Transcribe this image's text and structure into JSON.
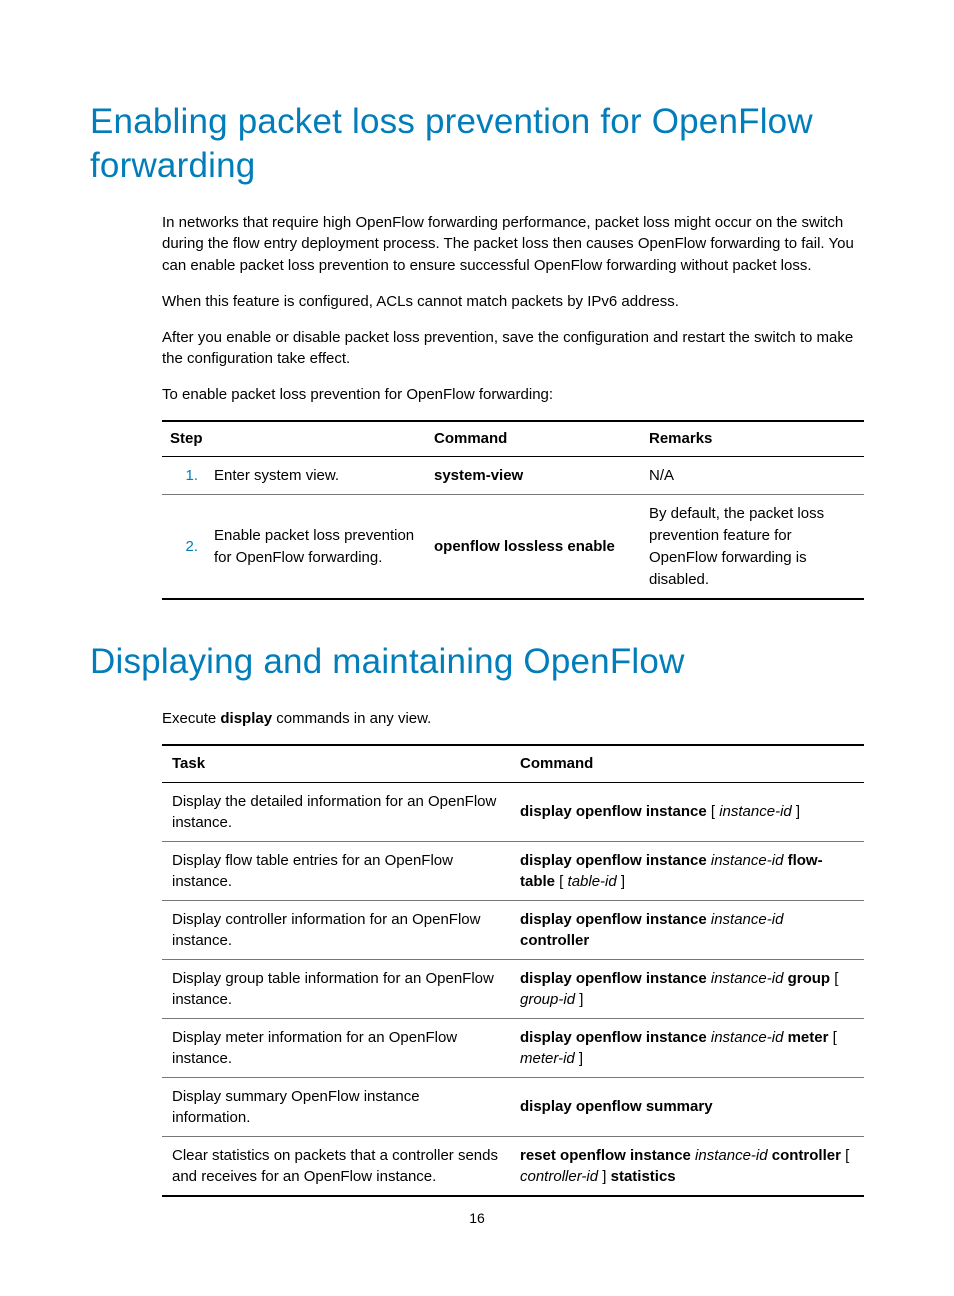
{
  "section1": {
    "title": "Enabling packet loss prevention for OpenFlow forwarding",
    "p1": "In networks that require high OpenFlow forwarding performance, packet loss might occur on the switch during the flow entry deployment process. The packet loss then causes OpenFlow forwarding to fail. You can enable packet loss prevention to ensure successful OpenFlow forwarding without packet loss.",
    "p2": "When this feature is configured, ACLs cannot match packets by IPv6 address.",
    "p3": "After you enable or disable packet loss prevention, save the configuration and restart the switch to make the configuration take effect.",
    "p4": "To enable packet loss prevention for OpenFlow forwarding:",
    "table": {
      "head_step": "Step",
      "head_command": "Command",
      "head_remarks": "Remarks",
      "rows": [
        {
          "num": "1.",
          "step": "Enter system view.",
          "command": "system-view",
          "remarks": "N/A"
        },
        {
          "num": "2.",
          "step": "Enable packet loss prevention for OpenFlow forwarding.",
          "command": "openflow lossless enable",
          "remarks": "By default, the packet loss prevention feature for OpenFlow forwarding is disabled."
        }
      ]
    }
  },
  "section2": {
    "title": "Displaying and maintaining OpenFlow",
    "intro_pre": "Execute ",
    "intro_bold": "display",
    "intro_post": " commands in any view.",
    "table": {
      "head_task": "Task",
      "head_command": "Command",
      "rows": [
        {
          "task": "Display the detailed information for an OpenFlow instance.",
          "cmd_parts": [
            {
              "t": "display openflow instance",
              "b": true,
              "i": false
            },
            {
              "t": " [ ",
              "b": false,
              "i": false
            },
            {
              "t": "instance-id",
              "b": false,
              "i": true
            },
            {
              "t": " ]",
              "b": false,
              "i": false
            }
          ]
        },
        {
          "task": "Display flow table entries for an OpenFlow instance.",
          "cmd_parts": [
            {
              "t": "display openflow instance",
              "b": true,
              "i": false
            },
            {
              "t": " ",
              "b": false,
              "i": false
            },
            {
              "t": "instance-id",
              "b": false,
              "i": true
            },
            {
              "t": " ",
              "b": false,
              "i": false
            },
            {
              "t": "flow-table",
              "b": true,
              "i": false
            },
            {
              "t": " [ ",
              "b": false,
              "i": false
            },
            {
              "t": "table-id",
              "b": false,
              "i": true
            },
            {
              "t": " ]",
              "b": false,
              "i": false
            }
          ]
        },
        {
          "task": "Display controller information for an OpenFlow instance.",
          "cmd_parts": [
            {
              "t": "display openflow instance",
              "b": true,
              "i": false
            },
            {
              "t": " ",
              "b": false,
              "i": false
            },
            {
              "t": "instance-id",
              "b": false,
              "i": true
            },
            {
              "t": " ",
              "b": false,
              "i": false
            },
            {
              "t": "controller",
              "b": true,
              "i": false
            }
          ]
        },
        {
          "task": "Display group table information for an OpenFlow instance.",
          "cmd_parts": [
            {
              "t": "display openflow instance",
              "b": true,
              "i": false
            },
            {
              "t": " ",
              "b": false,
              "i": false
            },
            {
              "t": "instance-id",
              "b": false,
              "i": true
            },
            {
              "t": " ",
              "b": false,
              "i": false
            },
            {
              "t": "group",
              "b": true,
              "i": false
            },
            {
              "t": " [ ",
              "b": false,
              "i": false
            },
            {
              "t": "group-id",
              "b": false,
              "i": true
            },
            {
              "t": " ]",
              "b": false,
              "i": false
            }
          ]
        },
        {
          "task": "Display meter information for an OpenFlow instance.",
          "cmd_parts": [
            {
              "t": "display openflow instance",
              "b": true,
              "i": false
            },
            {
              "t": " ",
              "b": false,
              "i": false
            },
            {
              "t": "instance-id",
              "b": false,
              "i": true
            },
            {
              "t": " ",
              "b": false,
              "i": false
            },
            {
              "t": "meter",
              "b": true,
              "i": false
            },
            {
              "t": " [ ",
              "b": false,
              "i": false
            },
            {
              "t": "meter-id",
              "b": false,
              "i": true
            },
            {
              "t": " ]",
              "b": false,
              "i": false
            }
          ]
        },
        {
          "task": "Display summary OpenFlow instance information.",
          "cmd_parts": [
            {
              "t": "display openflow summary",
              "b": true,
              "i": false
            }
          ]
        },
        {
          "task": "Clear statistics on packets that a controller sends and receives for an OpenFlow instance.",
          "cmd_parts": [
            {
              "t": "reset openflow instance",
              "b": true,
              "i": false
            },
            {
              "t": " ",
              "b": false,
              "i": false
            },
            {
              "t": "instance-id",
              "b": false,
              "i": true
            },
            {
              "t": " ",
              "b": false,
              "i": false
            },
            {
              "t": "controller",
              "b": true,
              "i": false
            },
            {
              "t": " [ ",
              "b": false,
              "i": false
            },
            {
              "t": "controller-id",
              "b": false,
              "i": true
            },
            {
              "t": " ] ",
              "b": false,
              "i": false
            },
            {
              "t": "statistics",
              "b": true,
              "i": false
            }
          ]
        }
      ]
    }
  },
  "page_number": "16"
}
